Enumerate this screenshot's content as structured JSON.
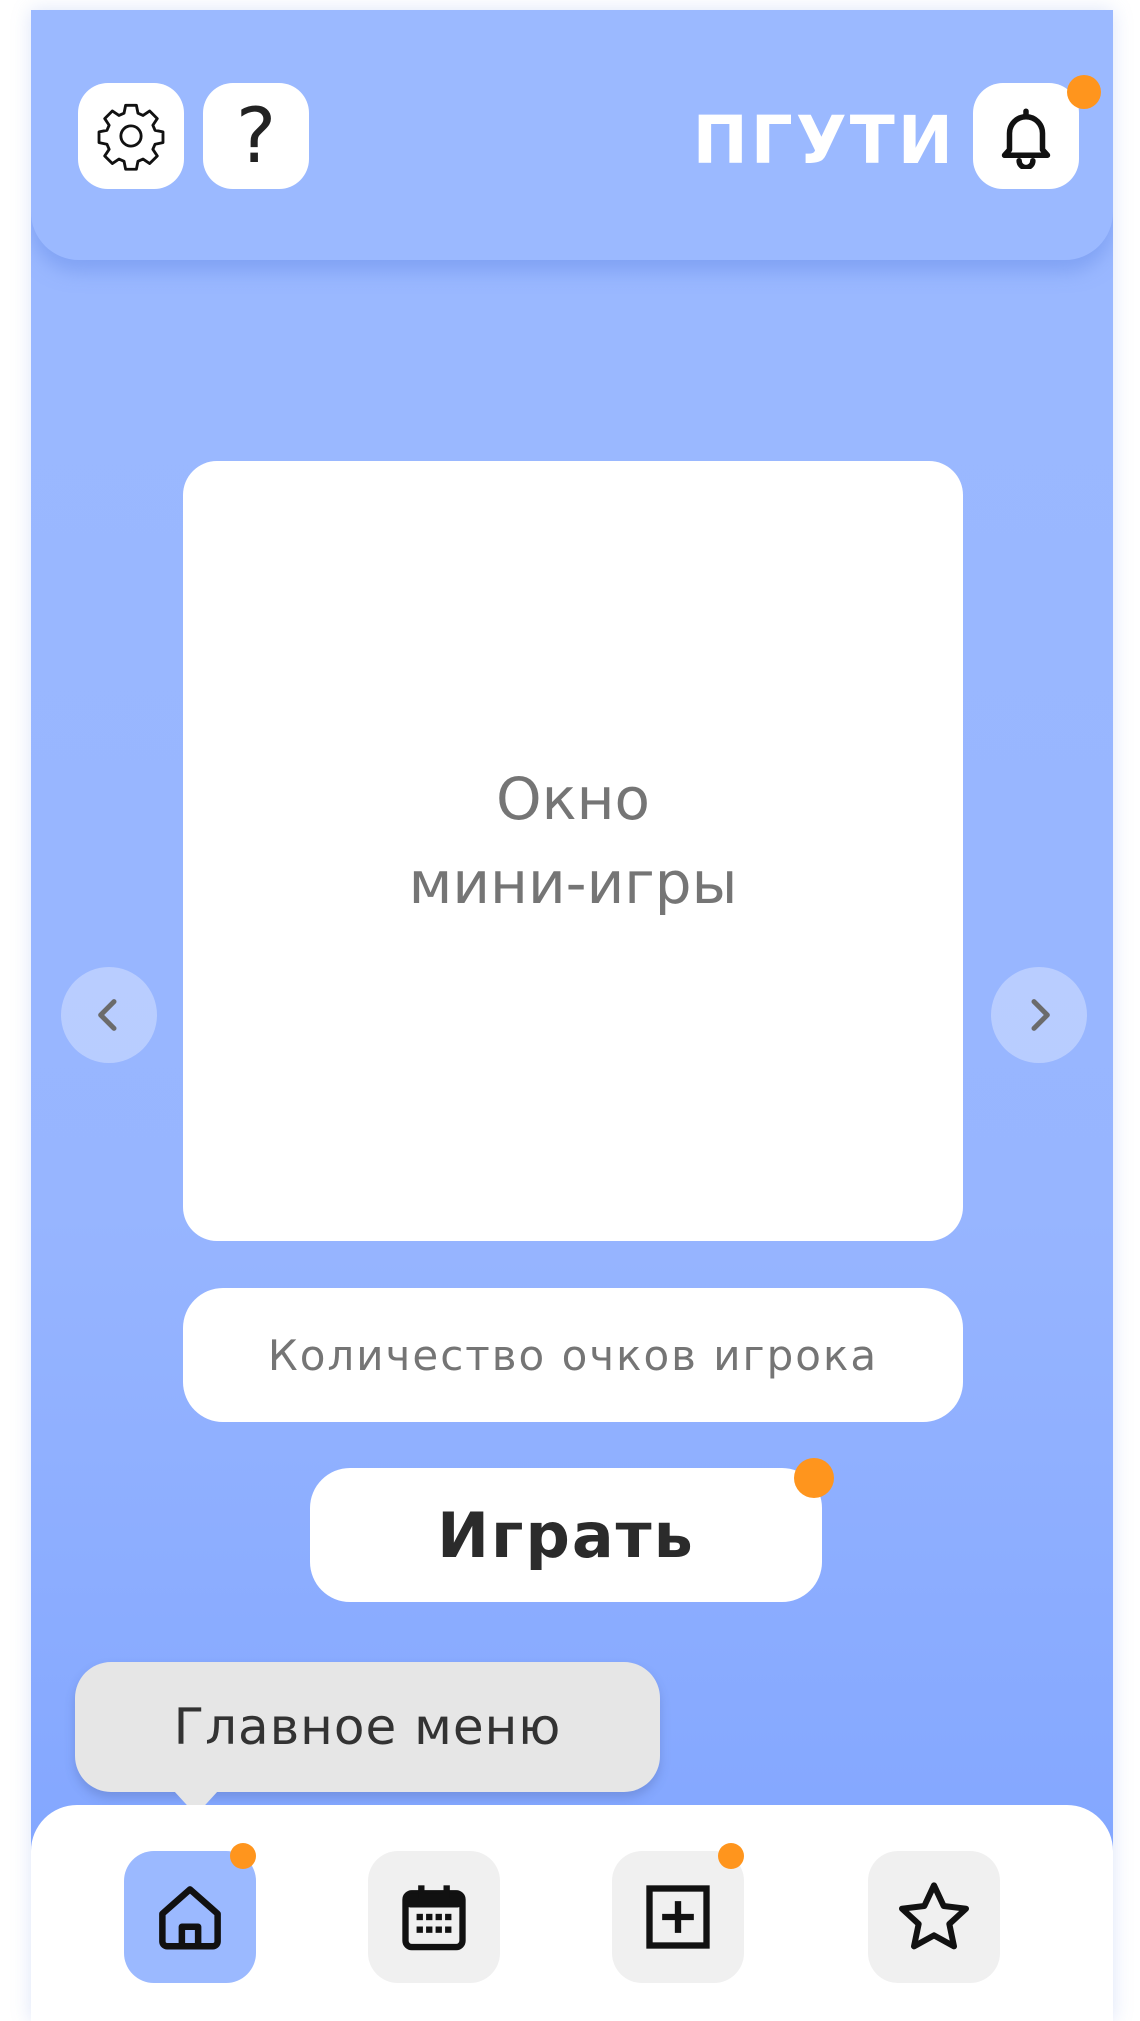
{
  "header": {
    "title": "ПГУТИ",
    "icons": {
      "settings": "gear-icon",
      "help": "question-icon",
      "notifications": "bell-icon"
    },
    "help_glyph": "?"
  },
  "game": {
    "window_label_line1": "Окно",
    "window_label_line2": "мини-игры",
    "prev_icon": "chevron-left-icon",
    "next_icon": "chevron-right-icon"
  },
  "score": {
    "placeholder": "Количество очков игрока"
  },
  "play_button": {
    "label": "Играть"
  },
  "tooltip": {
    "text": "Главное меню"
  },
  "bottom_nav": {
    "items": [
      {
        "icon": "home-icon",
        "active": true,
        "has_badge": true
      },
      {
        "icon": "calendar-icon",
        "active": false,
        "has_badge": false
      },
      {
        "icon": "plus-square-icon",
        "active": false,
        "has_badge": true
      },
      {
        "icon": "star-icon",
        "active": false,
        "has_badge": false
      }
    ]
  },
  "colors": {
    "background": "#9bb9ff",
    "accent_badge": "#ff951d",
    "card": "#ffffff",
    "muted_text": "#757575"
  }
}
